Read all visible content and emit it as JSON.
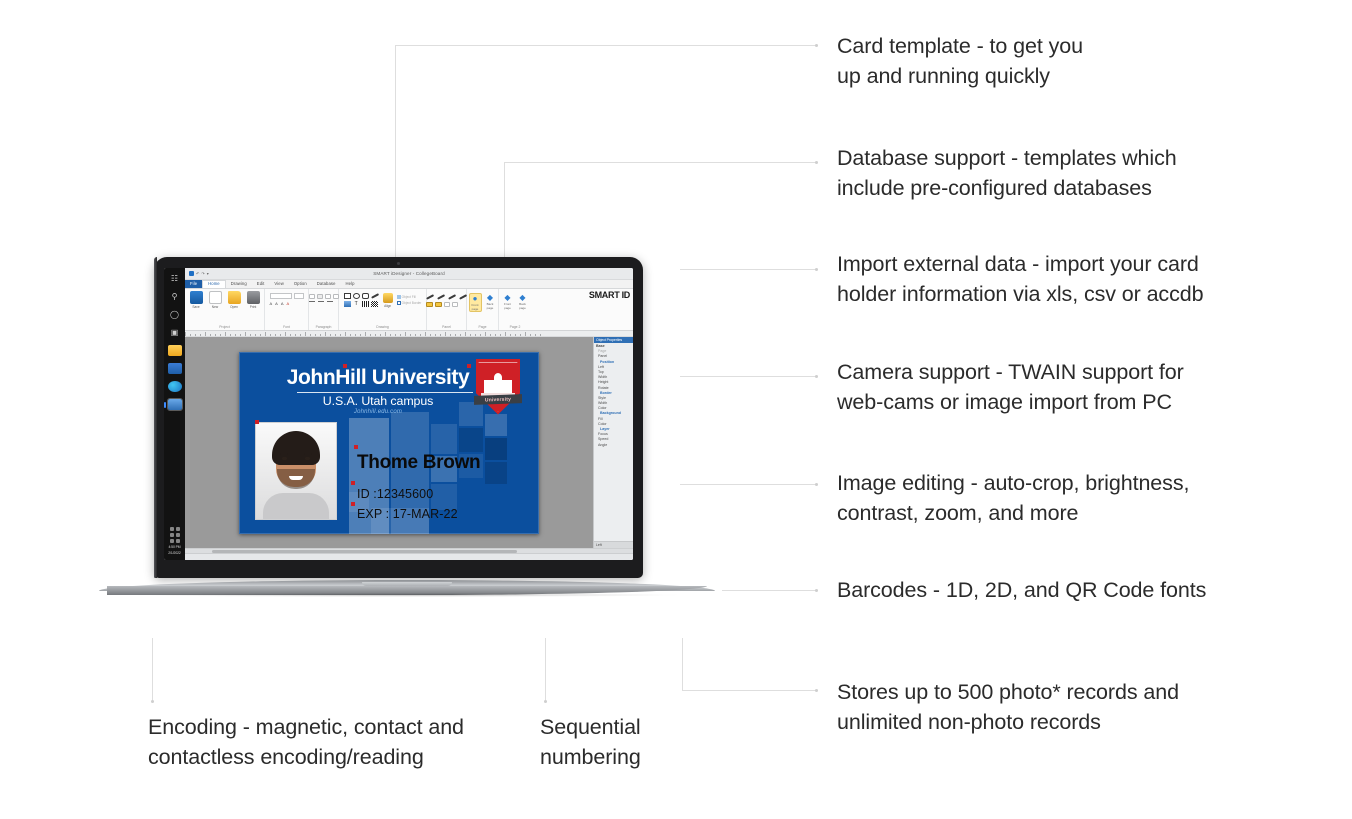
{
  "callouts": {
    "right": [
      {
        "id": "card-template",
        "text": "Card template - to get you\nup and running quickly"
      },
      {
        "id": "database-support",
        "text": "Database support - templates which\ninclude pre-configured databases"
      },
      {
        "id": "import-external-data",
        "text": "Import external data - import your card\nholder information via xls, csv or accdb"
      },
      {
        "id": "camera-support",
        "text": "Camera support - TWAIN support for\nweb-cams or image import from PC"
      },
      {
        "id": "image-editing",
        "text": "Image editing - auto-crop, brightness,\ncontrast, zoom, and more"
      },
      {
        "id": "barcodes",
        "text": "Barcodes - 1D, 2D, and QR Code fonts"
      },
      {
        "id": "storage",
        "text": "Stores up to 500 photo* records and\nunlimited non-photo records"
      }
    ],
    "bottom": [
      {
        "id": "encoding",
        "text": "Encoding - magnetic, contact and\ncontactless encoding/reading"
      },
      {
        "id": "sequential",
        "text": "Sequential\nnumbering"
      }
    ]
  },
  "app": {
    "window_title": "SMART iDesigner - CollegeBoard",
    "brand": "SMART ID",
    "quick_access": [
      "undo",
      "redo",
      "dropdown"
    ],
    "tabs": [
      "File",
      "Home",
      "Drawing",
      "Edit",
      "View",
      "Option",
      "Database",
      "Help"
    ],
    "active_tab": "Home",
    "groups": [
      {
        "label": "Project",
        "buttons": [
          "Save",
          "New",
          "Open",
          "Print"
        ]
      },
      {
        "label": "Font",
        "buttons": []
      },
      {
        "label": "Paragraph",
        "buttons": []
      },
      {
        "label": "Drawing",
        "buttons": [
          "Align"
        ]
      },
      {
        "label": "Panel",
        "buttons": []
      },
      {
        "label": "Page",
        "buttons": [
          "Front page",
          "Back page"
        ]
      },
      {
        "label": "Page 2",
        "buttons": [
          "Front page",
          "Back page"
        ]
      }
    ],
    "drawing_options": [
      "Object Fill",
      "Object Border"
    ],
    "properties": {
      "header": "Object Properties",
      "rows": [
        {
          "label": "Base",
          "kind": "root"
        },
        {
          "label": "Page",
          "kind": "disabled"
        },
        {
          "label": "Panel",
          "kind": "item"
        },
        {
          "label": "Position",
          "kind": "section"
        },
        {
          "label": "Left",
          "kind": "item"
        },
        {
          "label": "Top",
          "kind": "item"
        },
        {
          "label": "Width",
          "kind": "item"
        },
        {
          "label": "Height",
          "kind": "item"
        },
        {
          "label": "Rotate",
          "kind": "item"
        },
        {
          "label": "Border",
          "kind": "section"
        },
        {
          "label": "Style",
          "kind": "item"
        },
        {
          "label": "Width",
          "kind": "item"
        },
        {
          "label": "Color",
          "kind": "item"
        },
        {
          "label": "Background",
          "kind": "section"
        },
        {
          "label": "Fill",
          "kind": "item"
        },
        {
          "label": "Color",
          "kind": "item"
        },
        {
          "label": "Layer",
          "kind": "section"
        },
        {
          "label": "Focus",
          "kind": "item"
        },
        {
          "label": "Speed",
          "kind": "item"
        },
        {
          "label": "Angle",
          "kind": "item"
        }
      ],
      "footer": "Left"
    },
    "taskbar": {
      "clock_time": "4:50 PM",
      "clock_date": "2/1/2022"
    }
  },
  "id_card": {
    "university": "JohnHill University",
    "campus": "U.S.A. Utah campus",
    "website": "Johnhill.edu.com",
    "crest_banner": "University",
    "holder_name": "Thome Brown",
    "id_line": "ID :12345600",
    "exp_line": "EXP : 17-MAR-22",
    "background_color": "#0b4f9e"
  },
  "colors": {
    "text": "#2b2b2b",
    "connector": "#dedede",
    "card_blue": "#0b4f9e",
    "crest_red": "#cf2026",
    "ribbon_accent": "#1f5fa8"
  }
}
